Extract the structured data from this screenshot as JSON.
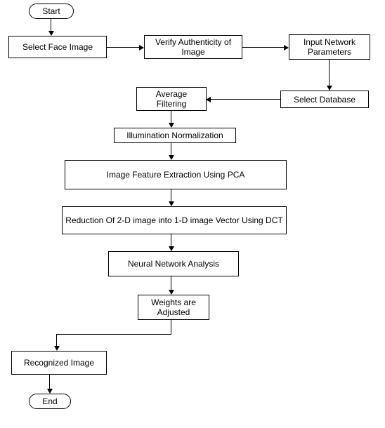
{
  "nodes": {
    "start": "Start",
    "selectFace": "Select Face Image",
    "verify": "Verify Authenticity of Image",
    "inputParams": "Input Network Parameters",
    "selectDb": "Select Database",
    "avgFilter": "Average Filtering",
    "illum": "Illumination Normalization",
    "pca": "Image Feature Extraction Using PCA",
    "dct": "Reduction Of 2-D image into 1-D image Vector Using DCT",
    "neural": "Neural Network Analysis",
    "weights": "Weights are Adjusted",
    "recognized": "Recognized Image",
    "end": "End"
  }
}
